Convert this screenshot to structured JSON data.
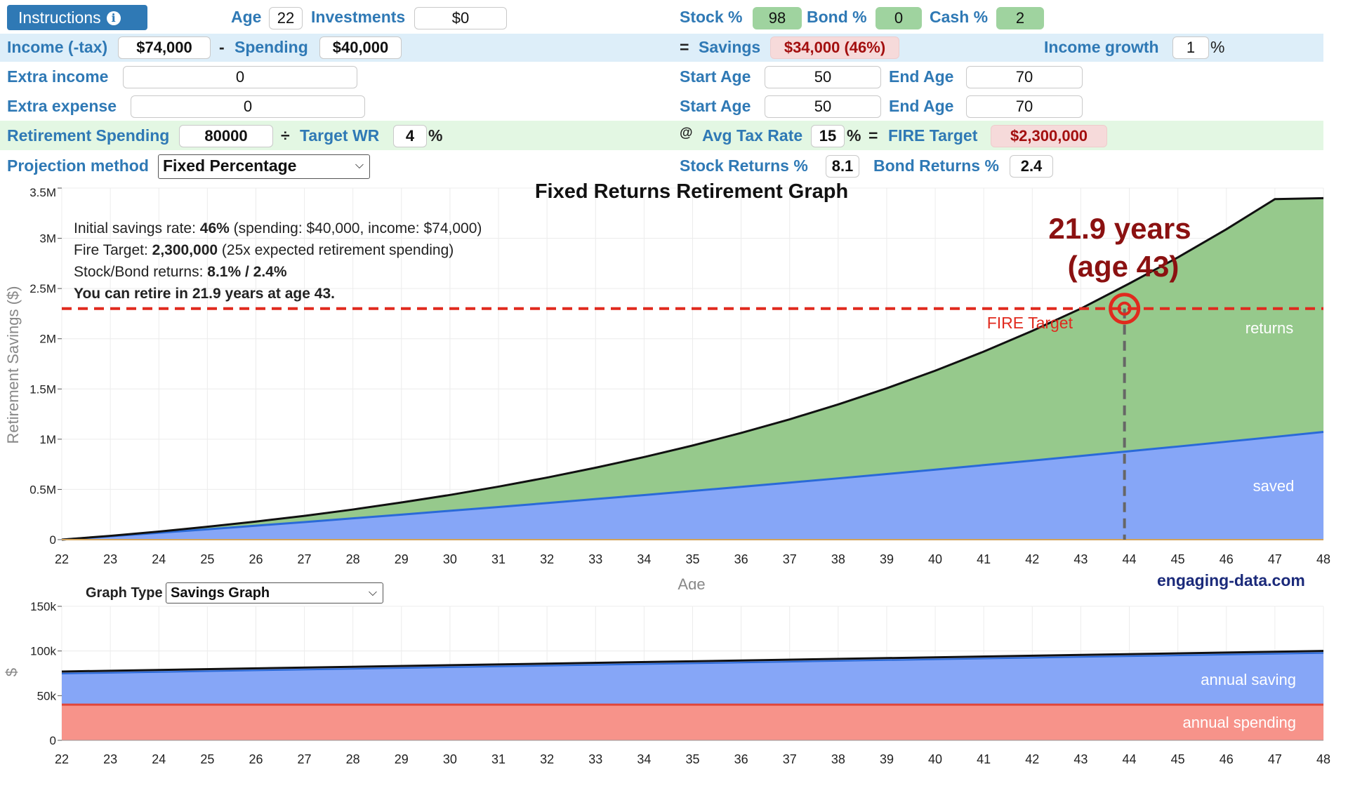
{
  "controls": {
    "instructions_label": "Instructions",
    "age_label": "Age",
    "age_value": "22",
    "investments_label": "Investments",
    "investments_value": "$0",
    "stock_label": "Stock %",
    "stock_value": "98",
    "bond_label": "Bond %",
    "bond_value": "0",
    "cash_label": "Cash %",
    "cash_value": "2",
    "income_label": "Income (-tax)",
    "income_value": "$74,000",
    "minus": "-",
    "spending_label": "Spending",
    "spending_value": "$40,000",
    "equals": "=",
    "savings_label": "Savings",
    "savings_value": "$34,000 (46%)",
    "income_growth_label": "Income growth",
    "income_growth_value": "1",
    "percent": "%",
    "extra_income_label": "Extra income",
    "extra_income_value": "0",
    "extra_expense_label": "Extra expense",
    "extra_expense_value": "0",
    "start_age_label": "Start Age",
    "end_age_label": "End Age",
    "extra_income_start": "50",
    "extra_income_end": "70",
    "extra_expense_start": "50",
    "extra_expense_end": "70",
    "retirement_spending_label": "Retirement Spending",
    "retirement_spending_value": "80000",
    "divide": "÷",
    "target_wr_label": "Target WR",
    "target_wr_value": "4",
    "at": "@",
    "avg_tax_label": "Avg Tax Rate",
    "avg_tax_value": "15",
    "fire_target_label": "FIRE Target",
    "fire_target_value": "$2,300,000",
    "projection_label": "Projection method",
    "projection_value": "Fixed Percentage",
    "stock_returns_label": "Stock Returns %",
    "stock_returns_value": "8.1",
    "bond_returns_label": "Bond Returns %",
    "bond_returns_value": "2.4",
    "graph_type_label": "Graph Type",
    "graph_type_value": "Savings Graph"
  },
  "summary": {
    "line1_pre": "Initial savings rate: ",
    "line1_bold": "46%",
    "line1_post": " (spending: $40,000, income: $74,000)",
    "line2_pre": "Fire Target: ",
    "line2_bold": "2,300,000",
    "line2_post": " (25x expected retirement spending)",
    "line3_pre": "Stock/Bond returns: ",
    "line3_bold": "8.1% / 2.4%",
    "line4": "You can retire in 21.9 years at age 43."
  },
  "brand": "engaging-data.com",
  "colors": {
    "returns": "#96c98c",
    "saved": "#86a6f7",
    "total_line": "#111111",
    "saved_line": "#2a6ad8",
    "fire": "#e02a1e",
    "spending": "#f7938a",
    "spending_line": "#e0463a",
    "label_dark_red": "#8b1111"
  },
  "chart_data": [
    {
      "type": "area",
      "title": "Fixed Returns Retirement Graph",
      "xlabel": "Age",
      "ylabel": "Retirement Savings ($)",
      "xlim": [
        22,
        48
      ],
      "ylim": [
        0,
        3500000
      ],
      "x_ticks": [
        "22",
        "23",
        "24",
        "25",
        "26",
        "27",
        "28",
        "29",
        "30",
        "31",
        "32",
        "33",
        "34",
        "35",
        "36",
        "37",
        "38",
        "39",
        "40",
        "41",
        "42",
        "43",
        "44",
        "45",
        "46",
        "47",
        "48"
      ],
      "y_ticks": [
        {
          "value": 0,
          "label": "0"
        },
        {
          "value": 500000,
          "label": "0.5M"
        },
        {
          "value": 1000000,
          "label": "1M"
        },
        {
          "value": 1500000,
          "label": "1.5M"
        },
        {
          "value": 2000000,
          "label": "2M"
        },
        {
          "value": 2500000,
          "label": "2.5M"
        },
        {
          "value": 3000000,
          "label": "3M"
        },
        {
          "value": 3500000,
          "label": "3.5M"
        }
      ],
      "x": [
        22,
        23,
        24,
        25,
        26,
        27,
        28,
        29,
        30,
        31,
        32,
        33,
        34,
        35,
        36,
        37,
        38,
        39,
        40,
        41,
        42,
        43,
        44,
        45,
        46,
        47,
        48
      ],
      "series": [
        {
          "name": "saved",
          "values": [
            0,
            34000,
            68000,
            103000,
            139000,
            175000,
            212000,
            249000,
            287000,
            325000,
            364000,
            404000,
            444000,
            485000,
            526000,
            568000,
            610000,
            653000,
            697000,
            742000,
            787000,
            833000,
            880000,
            927000,
            975000,
            1023000,
            1072000
          ]
        },
        {
          "name": "returns",
          "values": [
            0,
            38000,
            80000,
            128000,
            180000,
            237000,
            300000,
            370000,
            445000,
            528000,
            618000,
            716000,
            822000,
            937000,
            1062000,
            1198000,
            1346000,
            1507000,
            1682000,
            1872000,
            2078000,
            2300000,
            2550000,
            2810000,
            3090000,
            3390000,
            3400000
          ]
        }
      ],
      "fire_target": 2300000,
      "fire_target_label": "FIRE Target",
      "retire_age": 43.9,
      "annotation_line1": "21.9 years",
      "annotation_line2": "(age 43)"
    },
    {
      "type": "area",
      "ylabel": "$",
      "xlim": [
        22,
        48
      ],
      "ylim": [
        0,
        150000
      ],
      "x_ticks": [
        "22",
        "23",
        "24",
        "25",
        "26",
        "27",
        "28",
        "29",
        "30",
        "31",
        "32",
        "33",
        "34",
        "35",
        "36",
        "37",
        "38",
        "39",
        "40",
        "41",
        "42",
        "43",
        "44",
        "45",
        "46",
        "47",
        "48"
      ],
      "y_ticks": [
        {
          "value": 0,
          "label": "0"
        },
        {
          "value": 50000,
          "label": "50k"
        },
        {
          "value": 100000,
          "label": "100k"
        },
        {
          "value": 150000,
          "label": "150k"
        }
      ],
      "x": [
        22,
        48
      ],
      "series": [
        {
          "name": "annual saving",
          "values": [
            77000,
            100000
          ]
        },
        {
          "name": "annual spending",
          "values": [
            40000,
            40000
          ]
        }
      ]
    }
  ]
}
